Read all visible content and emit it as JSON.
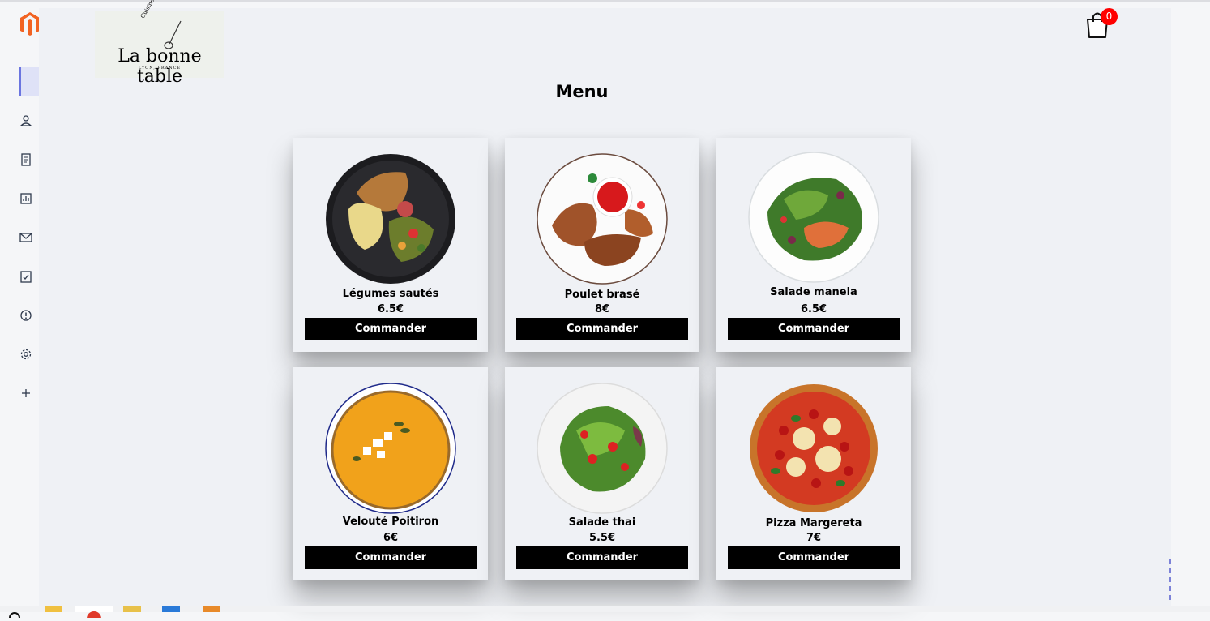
{
  "app": {
    "logo": {
      "top_text": "Cuisine du MONDE",
      "name": "La bonne table",
      "city": "LYON, FRANCE"
    },
    "cart": {
      "count": "0"
    },
    "accent_color": "#6b75e0",
    "badge_color": "#ff0000"
  },
  "sidebar": {
    "icons": [
      "dashboard-icon",
      "user-icon",
      "orders-icon",
      "chart-icon",
      "mail-icon",
      "clipboard-check-icon",
      "alert-icon",
      "settings-icon",
      "plus-icon"
    ]
  },
  "page": {
    "title": "Menu"
  },
  "menu": {
    "button_label": "Commander",
    "items": [
      {
        "name": "Légumes sautés",
        "price": "6.5€",
        "icon": "stir-fry-plate"
      },
      {
        "name": "Poulet brasé",
        "price": "8€",
        "icon": "chicken-plate"
      },
      {
        "name": "Salade manela",
        "price": "6.5€",
        "icon": "salmon-salad-plate"
      },
      {
        "name": "Velouté Poitiron",
        "price": "6€",
        "icon": "soup-bowl"
      },
      {
        "name": "Salade thai",
        "price": "5.5€",
        "icon": "salad-plate"
      },
      {
        "name": "Pizza Margereta",
        "price": "7€",
        "icon": "pizza"
      }
    ]
  }
}
